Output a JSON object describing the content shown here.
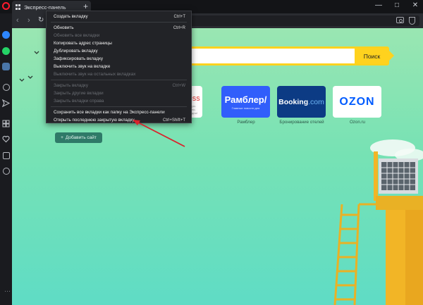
{
  "browser": {
    "tab_title": "Экспресс-панель",
    "new_tab_symbol": "+",
    "window_buttons": [
      "—",
      "□",
      "✕"
    ],
    "accent_color": "#ff1b2d"
  },
  "sidebar": {
    "icons": [
      "messenger-icon",
      "whatsapp-icon",
      "vk-icon",
      "search-icon",
      "send-icon",
      "grid-icon",
      "heart-icon",
      "news-icon",
      "history-icon"
    ],
    "more_symbol": "···"
  },
  "context_menu": {
    "items": [
      {
        "label": "Создать вкладку",
        "shortcut": "Ctrl+T",
        "enabled": true
      },
      {
        "label": "Обновить",
        "shortcut": "Ctrl+R",
        "enabled": true
      },
      {
        "label": "Обновить все вкладки",
        "shortcut": "",
        "enabled": false
      },
      {
        "label": "Копировать адрес страницы",
        "shortcut": "",
        "enabled": true
      },
      {
        "label": "Дублировать вкладку",
        "shortcut": "",
        "enabled": true
      },
      {
        "label": "Зафиксировать вкладку",
        "shortcut": "",
        "enabled": true
      },
      {
        "label": "Выключить звук на вкладке",
        "shortcut": "",
        "enabled": true
      },
      {
        "label": "Выключить звук на остальных вкладках",
        "shortcut": "",
        "enabled": false
      },
      {
        "label": "Закрыть вкладку",
        "shortcut": "Ctrl+W",
        "enabled": false
      },
      {
        "label": "Закрыть другие вкладки",
        "shortcut": "",
        "enabled": false
      },
      {
        "label": "Закрыть вкладки справа",
        "shortcut": "",
        "enabled": false
      },
      {
        "label": "Сохранить все вкладки как папку на Экспресс-панели",
        "shortcut": "",
        "enabled": true
      },
      {
        "label": "Открыть последнюю закрытую вкладку",
        "shortcut": "Ctrl+Shift+T",
        "enabled": true
      }
    ]
  },
  "speed_dial": {
    "search_button": "Поиск",
    "search_color": "#ffd21e",
    "tiles": [
      {
        "name": "express",
        "text": "ress",
        "subtext": "Быстро. Удобно. Выгодно!",
        "label": ""
      },
      {
        "name": "rambler",
        "text": "Рамблер/",
        "subtext": "Главные новости дня",
        "label": "Рамблер"
      },
      {
        "name": "booking",
        "text": "Booking",
        "text2": ".com",
        "label": "Бронирование отелей"
      },
      {
        "name": "ozon",
        "text": "OZON",
        "label": "Ozon.ru"
      }
    ],
    "add_site_label": "Добавить сайт",
    "add_site_symbol": "+"
  }
}
